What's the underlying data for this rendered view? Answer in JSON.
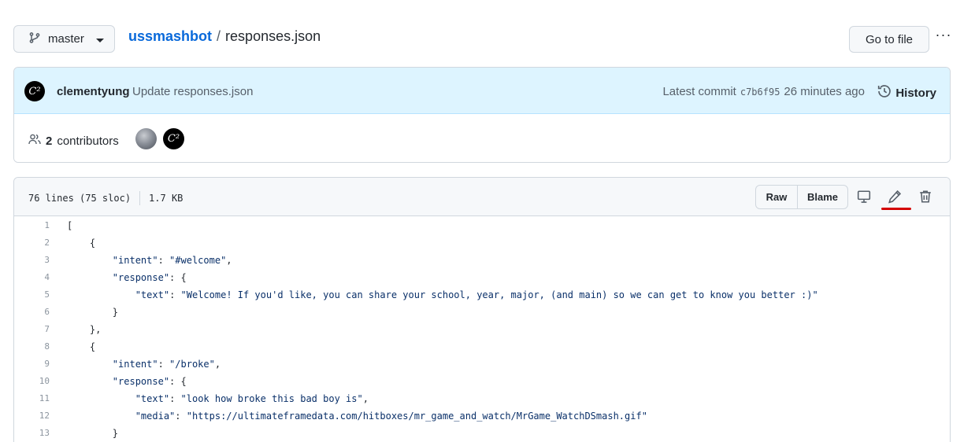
{
  "branch": {
    "label": "master",
    "icon": "git-branch-icon"
  },
  "breadcrumb": {
    "repo": "ussmashbot",
    "separator": "/",
    "file": "responses.json"
  },
  "goto_file_label": "Go to file",
  "more_label": "···",
  "commit": {
    "author": "clementyung",
    "message": "Update responses.json",
    "latest_label": "Latest commit",
    "sha": "c7b6f95",
    "time": "26 minutes ago",
    "history_label": "History",
    "avatar_text": "C²"
  },
  "contributors": {
    "count": "2",
    "label": "contributors"
  },
  "file": {
    "lines_info": "76 lines (75 sloc)",
    "size": "1.7 KB",
    "raw_label": "Raw",
    "blame_label": "Blame"
  },
  "code_lines": [
    {
      "n": "1",
      "text": "["
    },
    {
      "n": "2",
      "text": "    {"
    },
    {
      "n": "3",
      "text": "        \"intent\": \"#welcome\","
    },
    {
      "n": "4",
      "text": "        \"response\": {"
    },
    {
      "n": "5",
      "text": "            \"text\": \"Welcome! If you'd like, you can share your school, year, major, (and main) so we can get to know you better :)\""
    },
    {
      "n": "6",
      "text": "        }"
    },
    {
      "n": "7",
      "text": "    },"
    },
    {
      "n": "8",
      "text": "    {"
    },
    {
      "n": "9",
      "text": "        \"intent\": \"/broke\","
    },
    {
      "n": "10",
      "text": "        \"response\": {"
    },
    {
      "n": "11",
      "text": "            \"text\": \"look how broke this bad boy is\","
    },
    {
      "n": "12",
      "text": "            \"media\": \"https://ultimateframedata.com/hitboxes/mr_game_and_watch/MrGame_WatchDSmash.gif\""
    },
    {
      "n": "13",
      "text": "        }"
    }
  ],
  "colors": {
    "link": "#0969da",
    "commit_bg": "#ddf4ff",
    "highlight_red": "#d40000"
  }
}
